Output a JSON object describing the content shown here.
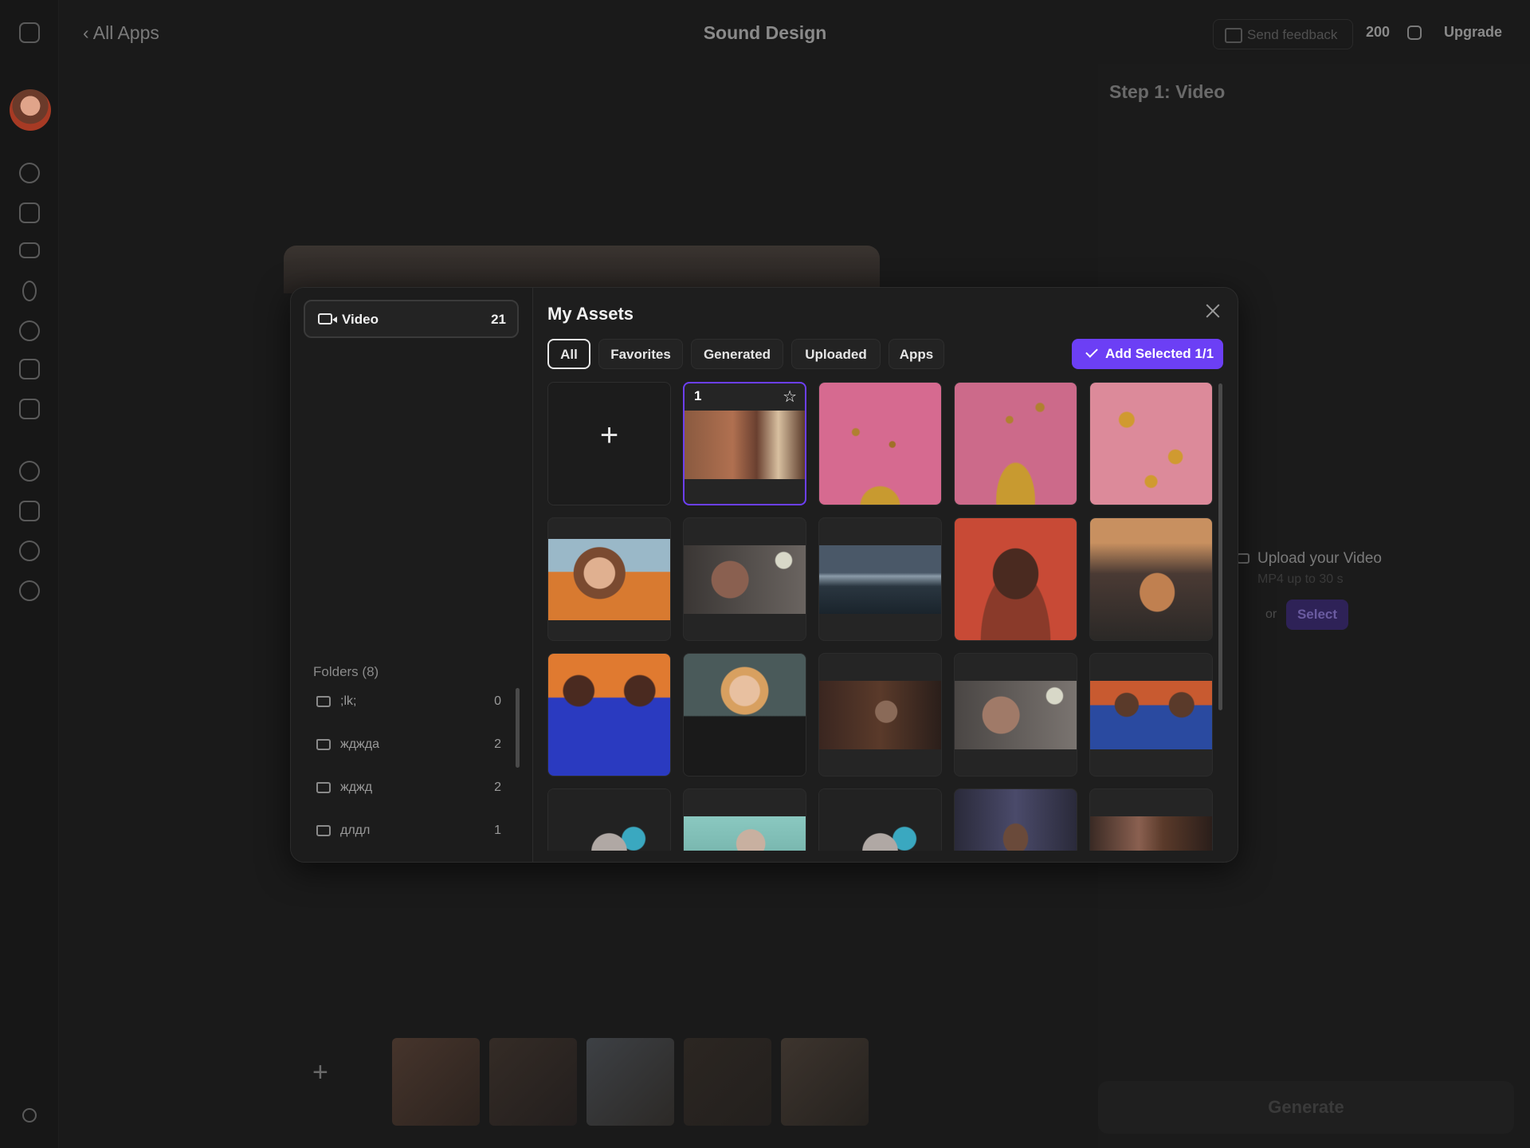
{
  "topbar": {
    "back_label": "All Apps",
    "title": "Sound Design",
    "feedback_label": "Send feedback",
    "credits": "200",
    "upgrade_label": "Upgrade"
  },
  "background": {
    "step_title": "Step 1: Video",
    "upload_title": "Upload your Video",
    "upload_sub": "MP4 up to 30 s",
    "or_label": "or",
    "select_label": "Select",
    "generate_label": "Generate"
  },
  "modal": {
    "title": "My Assets",
    "sidebar": {
      "video_label": "Video",
      "video_count": "21",
      "folders_title": "Folders (8)",
      "folders": [
        {
          "name": ";lk;",
          "count": "0"
        },
        {
          "name": "жджда",
          "count": "2"
        },
        {
          "name": "жджд",
          "count": "2"
        },
        {
          "name": "длдл",
          "count": "1"
        }
      ]
    },
    "filters": [
      "All",
      "Favorites",
      "Generated",
      "Uploaded",
      "Apps"
    ],
    "active_filter": "All",
    "add_selected_label": "Add Selected 1/1",
    "add_tile_symbol": "+",
    "selected_tile_number": "1",
    "favorite_symbol": "☆"
  },
  "colors": {
    "accent": "#6c3ff5",
    "background": "#151515",
    "modal": "#1e1e1e"
  },
  "icons": [
    "panel-icon",
    "chevron-left-icon",
    "feedback-icon",
    "credits-icon",
    "video-camera-icon",
    "folder-icon",
    "close-icon",
    "check-icon",
    "plus-icon",
    "star-icon"
  ]
}
